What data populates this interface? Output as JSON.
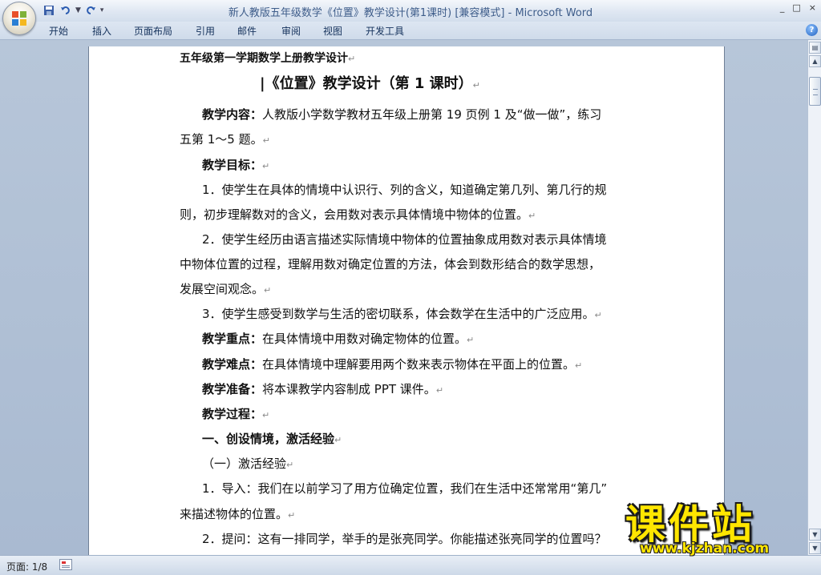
{
  "window": {
    "title": "新人教版五年级数学《位置》教学设计(第1课时) [兼容模式] - Microsoft Word",
    "controls": [
      "_",
      "□",
      "×"
    ]
  },
  "qat": {
    "save_icon": "save-icon",
    "undo_icon": "undo-icon",
    "redo_icon": "redo-icon",
    "customize": "▼"
  },
  "ribbon": {
    "tabs": [
      "开始",
      "插入",
      "页面布局",
      "引用",
      "邮件",
      "审阅",
      "视图",
      "开发工具"
    ],
    "help": "?"
  },
  "document": {
    "lines": [
      {
        "text": "五年级第一学期数学上册教学设计",
        "mark": "↵"
      },
      {
        "text": "|《位置》教学设计（第 1 课时）",
        "mark": "↵"
      },
      {
        "label": "教学内容：",
        "text": "人教版小学数学教材五年级上册第 19 页例 1 及“做一做”，练习"
      },
      {
        "text": "五第 1～5 题。",
        "mark": "↵"
      },
      {
        "label": "教学目标：",
        "mark": "↵"
      },
      {
        "text": "1．使学生在具体的情境中认识行、列的含义，知道确定第几列、第几行的规"
      },
      {
        "text": "则，初步理解数对的含义，会用数对表示具体情境中物体的位置。",
        "mark": "↵"
      },
      {
        "text": "2．使学生经历由语言描述实际情境中物体的位置抽象成用数对表示具体情境"
      },
      {
        "text": "中物体位置的过程，理解用数对确定位置的方法，体会到数形结合的数学思想，"
      },
      {
        "text": "发展空间观念。",
        "mark": "↵"
      },
      {
        "text": "3．使学生感受到数学与生活的密切联系，体会数学在生活中的广泛应用。",
        "mark": "↵"
      },
      {
        "label": "教学重点：",
        "text": "在具体情境中用数对确定物体的位置。",
        "mark": "↵"
      },
      {
        "label": "教学难点：",
        "text": "在具体情境中理解要用两个数来表示物体在平面上的位置。",
        "mark": "↵"
      },
      {
        "label": "教学准备：",
        "text": "将本课教学内容制成 PPT 课件。",
        "mark": "↵"
      },
      {
        "label": "教学过程：",
        "mark": "↵"
      },
      {
        "label": "一、创设情境，激活经验",
        "mark": "↵"
      },
      {
        "text": "（一）激活经验",
        "mark": "↵"
      },
      {
        "text": "1．导入：我们在以前学习了用方位确定位置，我们在生活中还常常用“第几”"
      },
      {
        "text": "来描述物体的位置。",
        "mark": "↵"
      },
      {
        "text": "2．提问：这有一排同学，举手的是张亮同学。你能描述张亮同学的位置吗？"
      }
    ]
  },
  "status": {
    "page": "页面: 1/8"
  },
  "watermark": {
    "brand": "课件站",
    "url": "www.kjzhan.com"
  }
}
